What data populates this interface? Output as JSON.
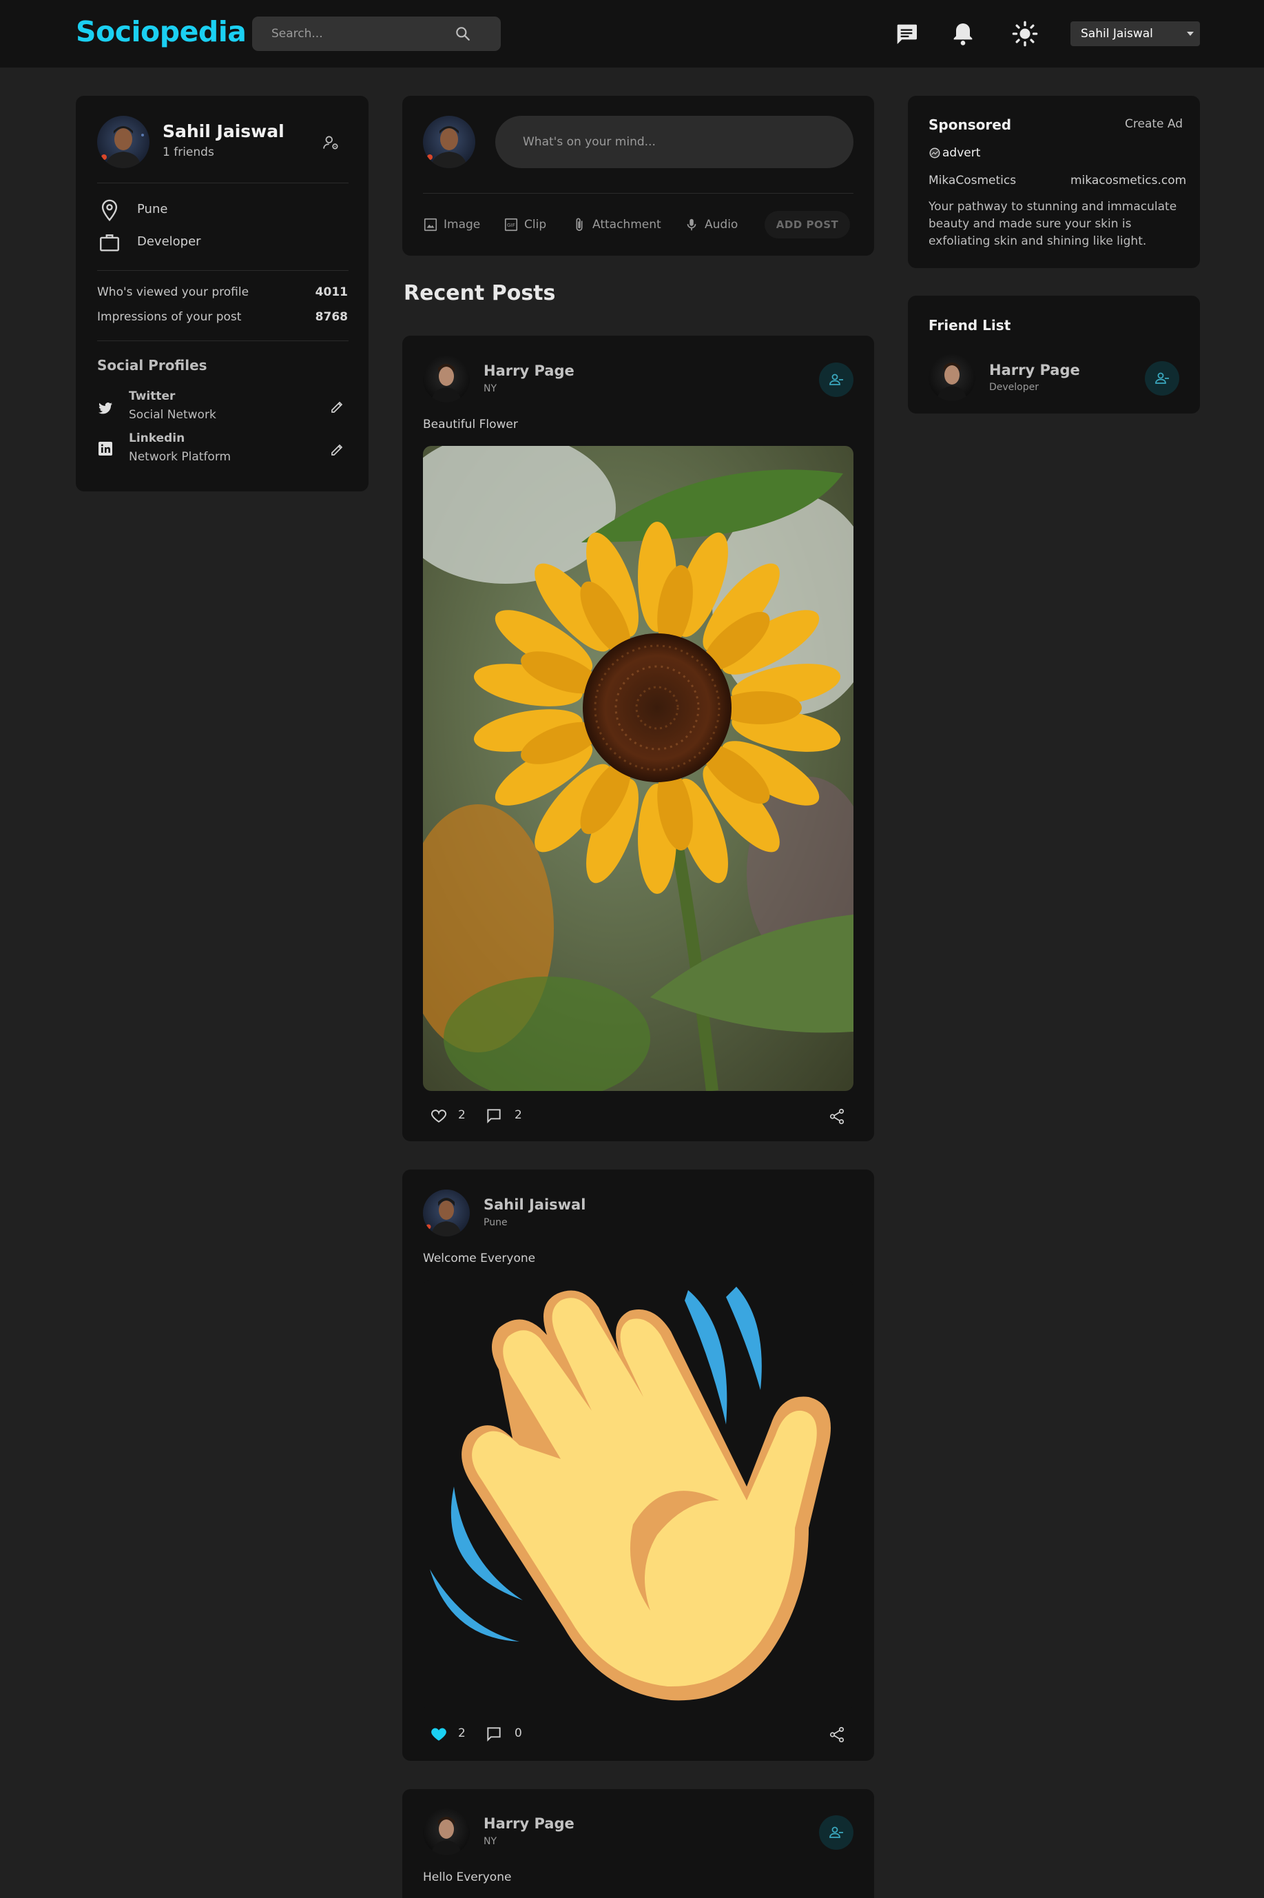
{
  "navbar": {
    "logo": "Sociopedia",
    "search_placeholder": "Search...",
    "user_select": "Sahil Jaiswal"
  },
  "profile": {
    "name": "Sahil Jaiswal",
    "friends": "1 friends",
    "location": "Pune",
    "occupation": "Developer",
    "stats": [
      {
        "label": "Who's viewed your profile",
        "value": "4011"
      },
      {
        "label": "Impressions of your post",
        "value": "8768"
      }
    ],
    "social_title": "Social Profiles",
    "socials": [
      {
        "name": "Twitter",
        "sub": "Social Network"
      },
      {
        "name": "Linkedin",
        "sub": "Network Platform"
      }
    ]
  },
  "composer": {
    "placeholder": "What's on your mind...",
    "tools": [
      "Image",
      "Clip",
      "Attachment",
      "Audio"
    ],
    "add_post": "ADD POST"
  },
  "feed": {
    "heading": "Recent Posts",
    "posts": [
      {
        "name": "Harry Page",
        "location": "NY",
        "description": "Beautiful Flower",
        "likes": "2",
        "comments": "2",
        "liked": false
      },
      {
        "name": "Sahil Jaiswal",
        "location": "Pune",
        "description": "Welcome Everyone",
        "likes": "2",
        "comments": "0",
        "liked": true
      },
      {
        "name": "Harry Page",
        "location": "NY",
        "description": "Hello Everyone"
      }
    ]
  },
  "sponsored": {
    "title": "Sponsored",
    "create_ad": "Create Ad",
    "image_alt": "advert",
    "brand": "MikaCosmetics",
    "website": "mikacosmetics.com",
    "description": "Your pathway to stunning and immaculate beauty and made sure your skin is exfoliating skin and shining like light."
  },
  "friend_list": {
    "title": "Friend List",
    "friends": [
      {
        "name": "Harry Page",
        "occupation": "Developer"
      }
    ]
  },
  "colors": {
    "accent": "#1bd0f2",
    "background": "#212121",
    "card": "#121212"
  }
}
